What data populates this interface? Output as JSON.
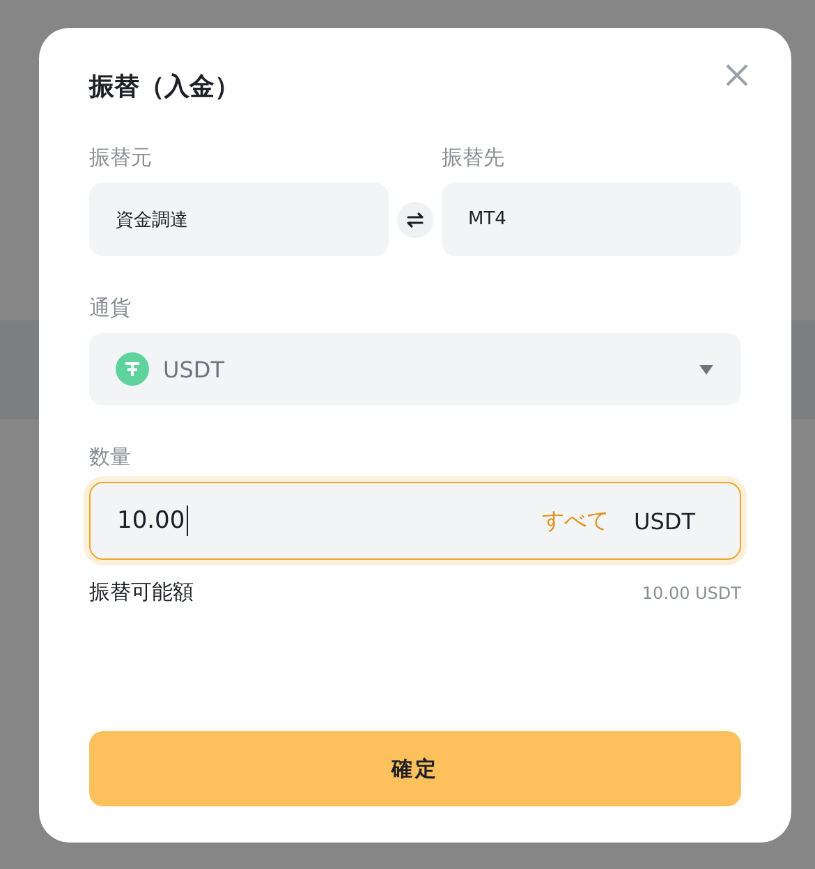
{
  "dialog": {
    "title": "振替（入金）",
    "from": {
      "label": "振替元",
      "value": "資金調達"
    },
    "to": {
      "label": "振替先",
      "value": "MT4"
    },
    "currency": {
      "label": "通貨",
      "value": "USDT"
    },
    "amount": {
      "label": "数量",
      "value": "10.00",
      "focused": true,
      "max_button": "すべて",
      "unit": "USDT"
    },
    "available": {
      "label": "振替可能額",
      "value": "10.00 USDT"
    },
    "confirm_button": "確定"
  }
}
